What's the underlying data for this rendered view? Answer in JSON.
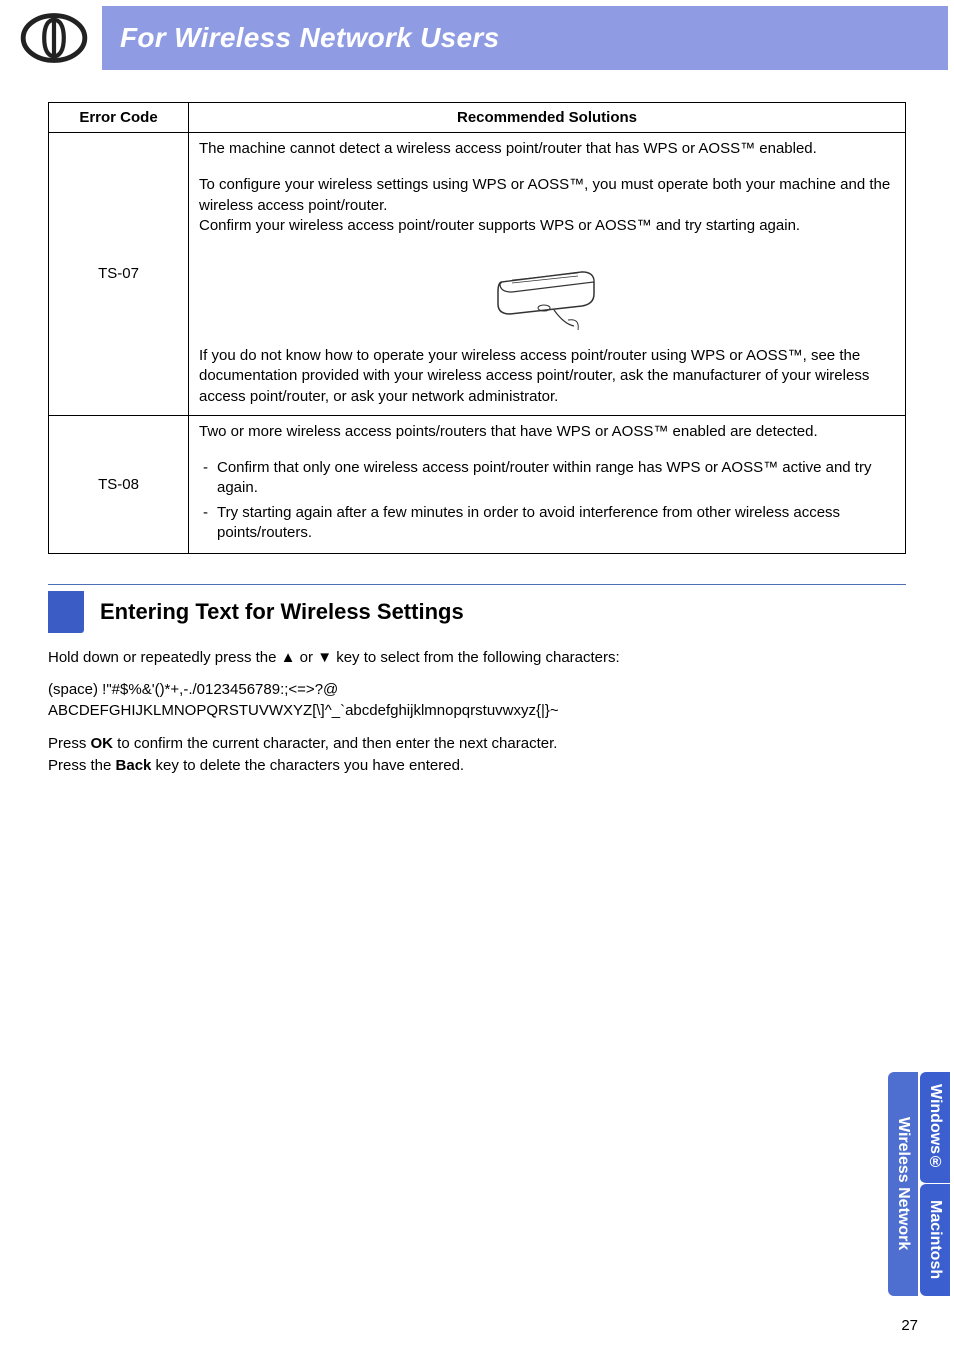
{
  "header": {
    "title": "For Wireless Network Users"
  },
  "table": {
    "head": {
      "col1": "Error Code",
      "col2": "Recommended Solutions"
    },
    "row1": {
      "code": "TS-07",
      "p1": "The machine cannot detect a wireless access point/router that has WPS or AOSS™ enabled.",
      "p2a": "To configure your wireless settings using WPS or AOSS™, you must operate both your machine and the wireless access point/router.",
      "p2b": "Confirm your wireless access point/router supports WPS or AOSS™ and try starting again.",
      "p3": "If you do not know how to operate your wireless access point/router using WPS or AOSS™, see the documentation provided with your wireless access point/router, ask the manufacturer of your wireless access point/router, or ask your network administrator."
    },
    "row2": {
      "code": "TS-08",
      "p1": "Two or more wireless access points/routers that have WPS or AOSS™ enabled are detected.",
      "b1": "Confirm that only one wireless access point/router within range has WPS or AOSS™ active and try again.",
      "b2": "Try starting again after a few minutes in order to avoid interference from other wireless access points/routers."
    }
  },
  "section": {
    "heading": "Entering Text for Wireless Settings",
    "intro_before": "Hold down or repeatedly press the ",
    "key_up": "▲",
    "intro_mid": " or ",
    "key_down": "▼",
    "intro_after": " key to select from the following characters:",
    "chars_line1": "(space) !\"#$%&'()*+,-./0123456789:;<=>?@",
    "chars_line2": "ABCDEFGHIJKLMNOPQRSTUVWXYZ[\\]^_`abcdefghijklmnopqrstuvwxyz{|}~",
    "p_ok_before": "Press ",
    "p_ok_bold": "OK",
    "p_ok_after": " to confirm the current character, and then enter the next character.",
    "p_back_before": "Press the ",
    "p_back_bold": "Back",
    "p_back_after": " key to delete the characters you have entered."
  },
  "tabs": {
    "wireless": "Wireless Network",
    "windows": "Windows®",
    "mac": "Macintosh"
  },
  "page_number": "27"
}
